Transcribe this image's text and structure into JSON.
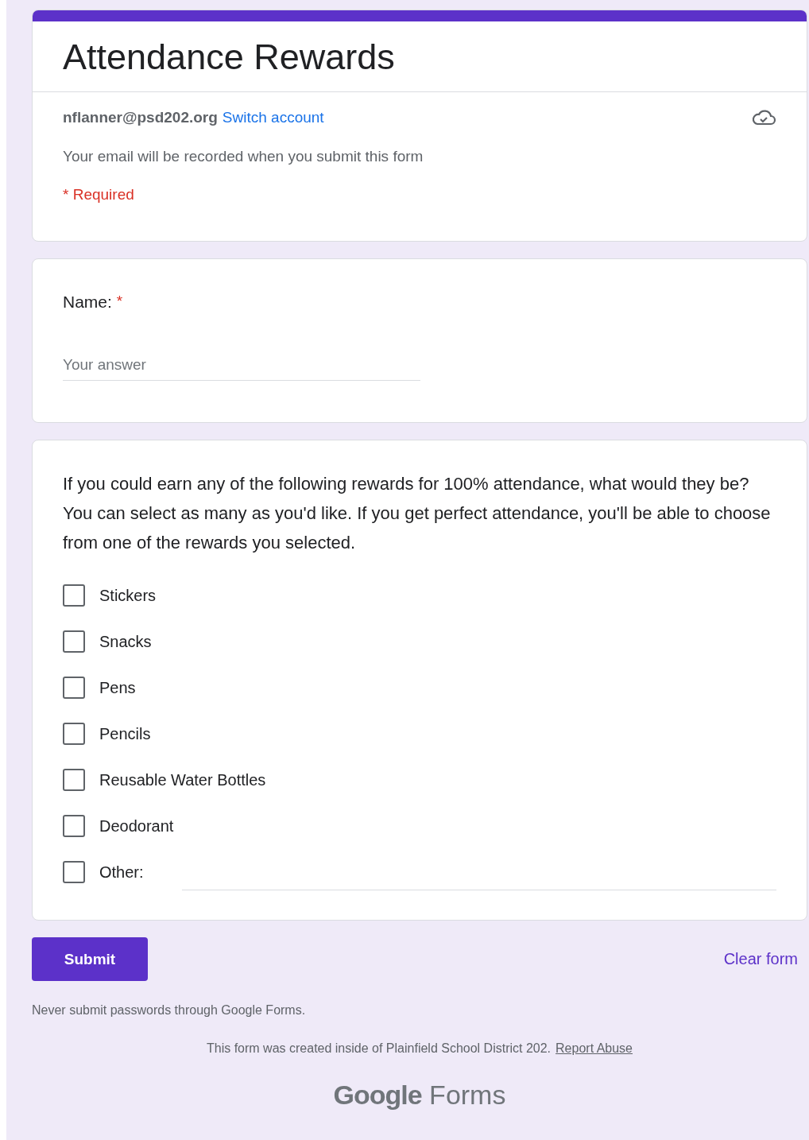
{
  "form": {
    "title": "Attendance Rewards",
    "account": "nflanner@psd202.org",
    "switch_account": "Switch account",
    "email_notice": "Your email will be recorded when you submit this form",
    "required_note": "* Required",
    "required_marker": "*"
  },
  "questions": [
    {
      "kind": "text",
      "label": "Name:",
      "required": true,
      "placeholder": "Your answer"
    },
    {
      "kind": "checkboxes",
      "label": "If you could earn any of the following rewards for 100% attendance, what would they be? You can select as many as you'd like. If you get perfect attendance, you'll be able to choose from one of the rewards you selected.",
      "required": false,
      "options": [
        {
          "kind": "option",
          "label": "Stickers",
          "checked": false
        },
        {
          "kind": "option",
          "label": "Snacks",
          "checked": false
        },
        {
          "kind": "option",
          "label": "Pens",
          "checked": false
        },
        {
          "kind": "option",
          "label": "Pencils",
          "checked": false
        },
        {
          "kind": "option",
          "label": "Reusable Water Bottles",
          "checked": false
        },
        {
          "kind": "option",
          "label": "Deodorant",
          "checked": false
        },
        {
          "kind": "other",
          "label": "Other:",
          "checked": false
        }
      ]
    }
  ],
  "actions": {
    "submit": "Submit",
    "clear": "Clear form"
  },
  "footer": {
    "password_notice": "Never submit passwords through Google Forms.",
    "created_notice": "This form was created inside of Plainfield School District 202.",
    "report_abuse": "Report Abuse",
    "logo_brand": "Google",
    "logo_product": "Forms"
  }
}
